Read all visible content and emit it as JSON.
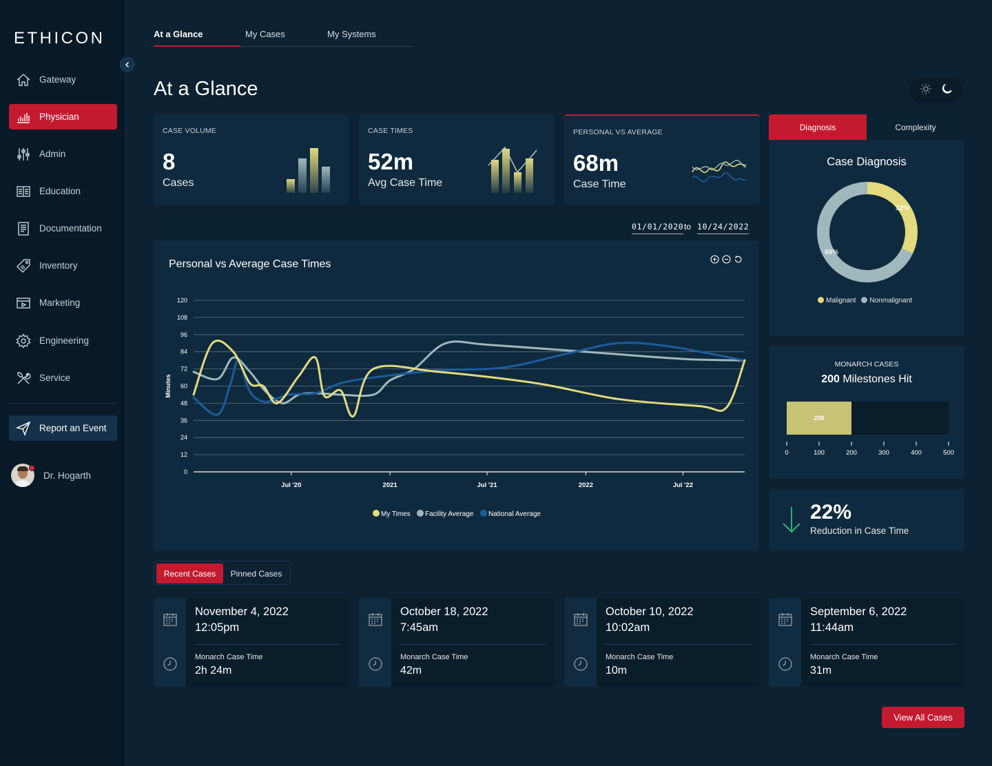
{
  "brand": {
    "logo_text": "ETHICON"
  },
  "sidebar": {
    "items": [
      {
        "label": "Gateway",
        "icon": "home-icon"
      },
      {
        "label": "Physician",
        "icon": "bar-chart-icon",
        "active": true
      },
      {
        "label": "Admin",
        "icon": "sliders-icon"
      },
      {
        "label": "Education",
        "icon": "book-icon"
      },
      {
        "label": "Documentation",
        "icon": "document-icon"
      },
      {
        "label": "Inventory",
        "icon": "tag-icon"
      },
      {
        "label": "Marketing",
        "icon": "presentation-icon"
      },
      {
        "label": "Engineering",
        "icon": "gear-icon"
      },
      {
        "label": "Service",
        "icon": "tools-icon"
      }
    ],
    "report_label": "Report an Event",
    "user_name": "Dr. Hogarth"
  },
  "tabs": [
    {
      "label": "At a Glance",
      "active": true
    },
    {
      "label": "My Cases"
    },
    {
      "label": "My Systems"
    }
  ],
  "page_title": "At a Glance",
  "stats": {
    "case_volume": {
      "label": "CASE VOLUME",
      "value": "8",
      "sub": "Cases"
    },
    "case_times": {
      "label": "CASE TIMES",
      "value": "52m",
      "sub": "Avg Case Time"
    },
    "personal_vs_average": {
      "label": "PERSONAL VS AVERAGE",
      "value": "68m",
      "sub": "Case Time"
    }
  },
  "date_range": {
    "from": "01/01/2020",
    "to_label": "to",
    "to": "10/24/2022"
  },
  "chart": {
    "title": "Personal vs Average Case Times"
  },
  "diagnosis": {
    "tabs": [
      "Diagnosis",
      "Complexity"
    ],
    "title": "Case Diagnosis",
    "legend": [
      "Malignant",
      "Nonmalignant"
    ]
  },
  "monarch": {
    "label": "MONARCH CASES",
    "count": "200",
    "suffix": "Milestones Hit"
  },
  "reduction": {
    "value": "22%",
    "label": "Reduction in Case Time"
  },
  "case_tabs": [
    "Recent Cases",
    "Pinned Cases"
  ],
  "cases": [
    {
      "date": "November 4, 2022",
      "time": "12:05pm",
      "meta_label": "Monarch Case Time",
      "meta_value": "2h 24m"
    },
    {
      "date": "October 18, 2022",
      "time": "7:45am",
      "meta_label": "Monarch Case Time",
      "meta_value": "42m"
    },
    {
      "date": "October 10, 2022",
      "time": "10:02am",
      "meta_label": "Monarch Case Time",
      "meta_value": "10m"
    },
    {
      "date": "September 6, 2022",
      "time": "11:44am",
      "meta_label": "Monarch Case Time",
      "meta_value": "31m"
    }
  ],
  "view_all_label": "View All Cases",
  "colors": {
    "accent": "#c41a30",
    "my_times": "#e3da7e",
    "facility": "#9fb8bc",
    "national": "#1b5d9c",
    "reduction_arrow": "#2fbf86"
  },
  "chart_data": [
    {
      "type": "line",
      "title": "Personal vs Average Case Times",
      "ylabel": "Minutes",
      "ylim": [
        0,
        120
      ],
      "yticks": [
        0,
        12,
        24,
        36,
        48,
        60,
        72,
        84,
        96,
        108,
        120
      ],
      "xlim": [
        "2020-01-01",
        "2022-10-24"
      ],
      "xticks": [
        {
          "label": "Jul '20",
          "x": "2020-07-01"
        },
        {
          "label": "2021",
          "x": "2021-01-01"
        },
        {
          "label": "Jul '21",
          "x": "2021-07-01"
        },
        {
          "label": "2022",
          "x": "2022-01-01"
        },
        {
          "label": "Jul '22",
          "x": "2022-07-01"
        }
      ],
      "legend_position": "bottom",
      "grid": true,
      "series": [
        {
          "name": "My Times",
          "color": "#e3da7e",
          "points": [
            [
              "2020-01-01",
              54
            ],
            [
              "2020-02-05",
              90
            ],
            [
              "2020-03-15",
              84
            ],
            [
              "2020-04-15",
              62
            ],
            [
              "2020-05-10",
              60
            ],
            [
              "2020-06-05",
              48
            ],
            [
              "2020-07-15",
              67
            ],
            [
              "2020-08-15",
              80
            ],
            [
              "2020-09-01",
              53
            ],
            [
              "2020-10-01",
              57
            ],
            [
              "2020-10-25",
              39
            ],
            [
              "2020-12-01",
              72
            ],
            [
              "2021-04-01",
              70
            ],
            [
              "2021-10-01",
              62
            ],
            [
              "2022-03-01",
              51
            ],
            [
              "2022-08-01",
              46
            ],
            [
              "2022-09-20",
              45
            ],
            [
              "2022-10-24",
              78
            ]
          ]
        },
        {
          "name": "Facility Average",
          "color": "#9fb8bc",
          "points": [
            [
              "2020-01-01",
              70
            ],
            [
              "2020-02-15",
              65
            ],
            [
              "2020-03-15",
              80
            ],
            [
              "2020-04-15",
              70
            ],
            [
              "2020-05-15",
              56
            ],
            [
              "2020-06-15",
              48
            ],
            [
              "2020-07-15",
              54
            ],
            [
              "2020-08-15",
              55
            ],
            [
              "2020-10-01",
              54
            ],
            [
              "2020-12-01",
              54
            ],
            [
              "2021-01-01",
              64
            ],
            [
              "2021-02-15",
              72
            ],
            [
              "2021-04-15",
              90
            ],
            [
              "2021-07-01",
              89
            ],
            [
              "2022-01-01",
              84
            ],
            [
              "2022-07-01",
              79
            ],
            [
              "2022-10-24",
              78
            ]
          ]
        },
        {
          "name": "National Average",
          "color": "#1b5d9c",
          "points": [
            [
              "2020-01-01",
              52
            ],
            [
              "2020-02-15",
              40
            ],
            [
              "2020-03-10",
              62
            ],
            [
              "2020-03-25",
              78
            ],
            [
              "2020-04-15",
              56
            ],
            [
              "2020-05-15",
              49
            ],
            [
              "2020-06-25",
              54
            ],
            [
              "2020-08-15",
              55
            ],
            [
              "2020-10-01",
              62
            ],
            [
              "2020-12-01",
              66
            ],
            [
              "2021-04-01",
              71
            ],
            [
              "2021-08-01",
              73
            ],
            [
              "2021-12-01",
              83
            ],
            [
              "2022-03-01",
              90
            ],
            [
              "2022-06-01",
              88
            ],
            [
              "2022-10-24",
              78
            ]
          ]
        }
      ]
    },
    {
      "type": "pie",
      "title": "Case Diagnosis",
      "variant": "donut",
      "categories": [
        "Malignant",
        "Nonmalignant"
      ],
      "values": [
        32,
        68
      ],
      "data_labels": [
        "32%",
        "68%"
      ],
      "colors": [
        "#e3da7e",
        "#9fb8bc"
      ],
      "legend_position": "bottom"
    },
    {
      "type": "bar",
      "orientation": "horizontal",
      "title": "MONARCH CASES",
      "categories": [
        "Milestones Hit"
      ],
      "values": [
        200
      ],
      "data_labels": [
        "200"
      ],
      "xlim": [
        0,
        500
      ],
      "xticks": [
        0,
        100,
        200,
        300,
        400,
        500
      ],
      "color": "#c7c274"
    }
  ]
}
